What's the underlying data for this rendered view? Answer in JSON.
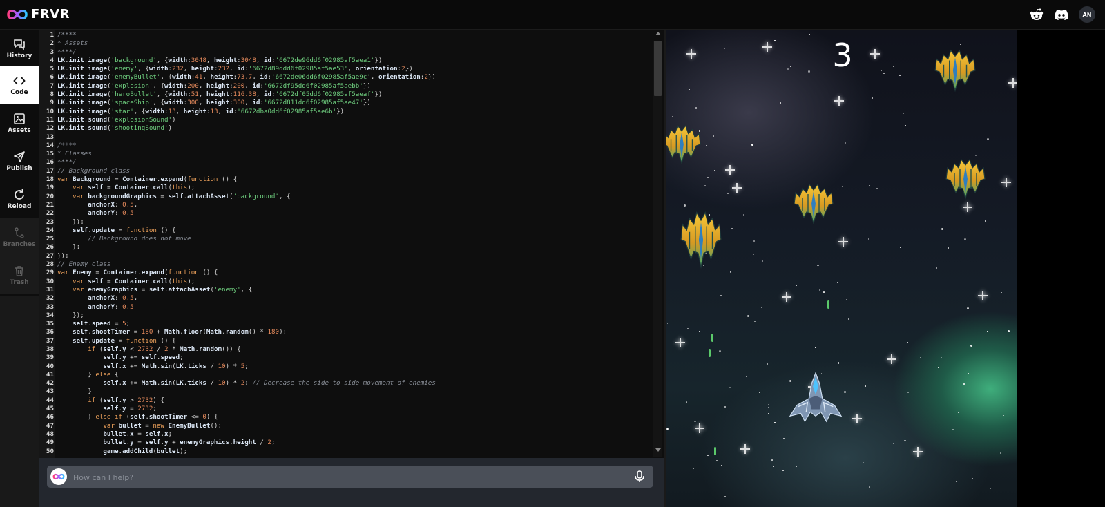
{
  "header": {
    "brand": "FRVR",
    "user_initials": "AN",
    "icons": [
      "reddit-icon",
      "discord-icon"
    ]
  },
  "sidebar": {
    "items": [
      {
        "label": "History",
        "icon": "history-icon",
        "state": "normal"
      },
      {
        "label": "Code",
        "icon": "code-icon",
        "state": "active"
      },
      {
        "label": "Assets",
        "icon": "image-icon",
        "state": "normal"
      },
      {
        "label": "Publish",
        "icon": "send-icon",
        "state": "normal"
      },
      {
        "label": "Reload",
        "icon": "reload-icon",
        "state": "normal"
      },
      {
        "label": "Branches",
        "icon": "branch-icon",
        "state": "disabled"
      },
      {
        "label": "Trash",
        "icon": "trash-icon",
        "state": "disabled"
      }
    ]
  },
  "editor": {
    "lines": [
      "/****",
      "* Assets",
      "****/",
      "LK.init.image('background', {width:3048, height:3048, id:'6672de96dd6f02985af5aea1'})",
      "LK.init.image('enemy', {width:232, height:232, id:'6672d89ddd6f02985af5ae53', orientation:2})",
      "LK.init.image('enemyBullet', {width:41, height:73.7, id:'6672de06dd6f02985af5ae9c', orientation:2})",
      "LK.init.image('explosion', {width:200, height:200, id:'6672df95dd6f02985af5aebb'})",
      "LK.init.image('heroBullet', {width:51, height:116.38, id:'6672df05dd6f02985af5aeaf'})",
      "LK.init.image('spaceShip', {width:300, height:300, id:'6672d811dd6f02985af5ae47'})",
      "LK.init.image('star', {width:13, height:13, id:'6672dba0dd6f02985af5ae6b'})",
      "LK.init.sound('explosionSound')",
      "LK.init.sound('shootingSound')",
      "",
      "/****",
      "* Classes",
      "****/",
      "// Background class",
      "var Background = Container.expand(function () {",
      "    var self = Container.call(this);",
      "    var backgroundGraphics = self.attachAsset('background', {",
      "        anchorX: 0.5,",
      "        anchorY: 0.5",
      "    });",
      "    self.update = function () {",
      "        // Background does not move",
      "    };",
      "});",
      "// Enemy class",
      "var Enemy = Container.expand(function () {",
      "    var self = Container.call(this);",
      "    var enemyGraphics = self.attachAsset('enemy', {",
      "        anchorX: 0.5,",
      "        anchorY: 0.5",
      "    });",
      "    self.speed = 5;",
      "    self.shootTimer = 180 + Math.floor(Math.random() * 180);",
      "    self.update = function () {",
      "        if (self.y < 2732 / 2 * Math.random()) {",
      "            self.y += self.speed;",
      "            self.x += Math.sin(LK.ticks / 10) * 5;",
      "        } else {",
      "            self.x += Math.sin(LK.ticks / 10) * 2; // Decrease the side to side movement of enemies",
      "        }",
      "        if (self.y > 2732) {",
      "            self.y = 2732;",
      "        } else if (self.shootTimer <= 0) {",
      "            var bullet = new EnemyBullet();",
      "            bullet.x = self.x;",
      "            bullet.y = self.y + enemyGraphics.height / 2;",
      "            game.addChild(bullet);"
    ]
  },
  "prompt": {
    "placeholder": "How can I help?"
  },
  "game": {
    "score": "3"
  },
  "colors": {
    "keyword": "#f0a35c",
    "string": "#6fcf7f",
    "number": "#e58a5c",
    "comment": "#8a8f98",
    "identifier": "#d9e4f2",
    "accent_green": "#5bc96a"
  }
}
